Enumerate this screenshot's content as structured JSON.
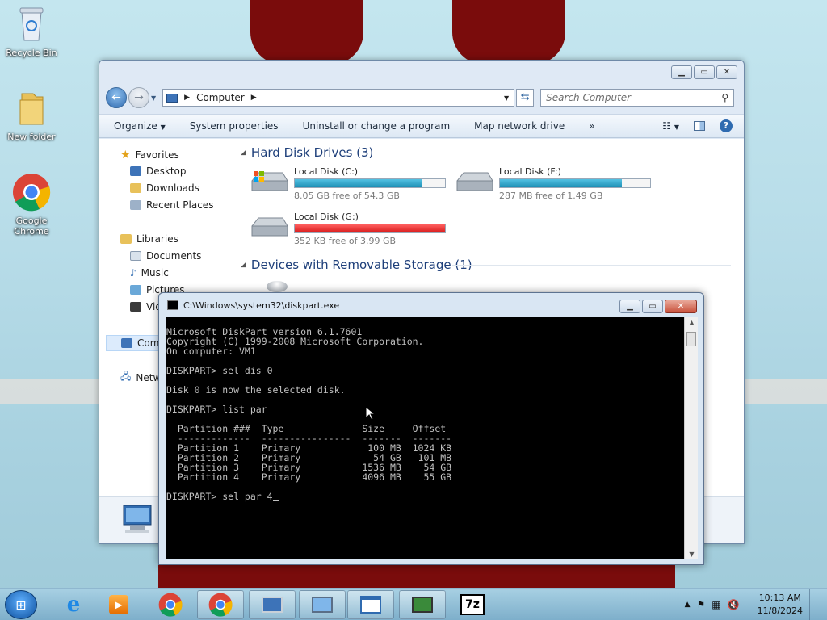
{
  "desktop": {
    "icons": [
      {
        "label": "Recycle Bin",
        "icon": "recycle-bin-icon"
      },
      {
        "label": "New folder",
        "icon": "folder-icon"
      },
      {
        "label": "Google Chrome",
        "icon": "chrome-icon"
      }
    ]
  },
  "explorer": {
    "address": {
      "root": "Computer"
    },
    "search_placeholder": "Search Computer",
    "toolbar": [
      "Organize",
      "System properties",
      "Uninstall or change a program",
      "Map network drive",
      "»"
    ],
    "nav": {
      "favorites": "Favorites",
      "favorites_items": [
        "Desktop",
        "Downloads",
        "Recent Places"
      ],
      "libraries": "Libraries",
      "libraries_items": [
        "Documents",
        "Music",
        "Pictures",
        "Vid"
      ],
      "computer": "Com",
      "network": "Netw"
    },
    "groups": {
      "hard_disk": "Hard Disk Drives (3)",
      "removable": "Devices with Removable Storage (1)"
    },
    "drives": [
      {
        "name": "Local Disk (C:)",
        "free_text": "8.05 GB free of 54.3 GB",
        "used_fraction": 0.85,
        "color": "#2a9cc4"
      },
      {
        "name": "Local Disk (F:)",
        "free_text": "287 MB free of 1.49 GB",
        "used_fraction": 0.81,
        "color": "#2a9cc4"
      },
      {
        "name": "Local Disk (G:)",
        "free_text": "352 KB free of 3.99 GB",
        "used_fraction": 1.0,
        "color": "#d81c1c"
      }
    ]
  },
  "cmd": {
    "title": "C:\\Windows\\system32\\diskpart.exe",
    "lines": [
      "Microsoft DiskPart version 6.1.7601",
      "Copyright (C) 1999-2008 Microsoft Corporation.",
      "On computer: VM1",
      "",
      "DISKPART> sel dis 0",
      "",
      "Disk 0 is now the selected disk.",
      "",
      "DISKPART> list par",
      "",
      "  Partition ###  Type              Size     Offset",
      "  -------------  ----------------  -------  -------",
      "  Partition 1    Primary            100 MB  1024 KB",
      "  Partition 2    Primary             54 GB   101 MB",
      "  Partition 3    Primary           1536 MB    54 GB",
      "  Partition 4    Primary           4096 MB    55 GB",
      "",
      "DISKPART> sel par 4"
    ]
  },
  "tray": {
    "time": "10:13 AM",
    "date": "11/8/2024"
  }
}
